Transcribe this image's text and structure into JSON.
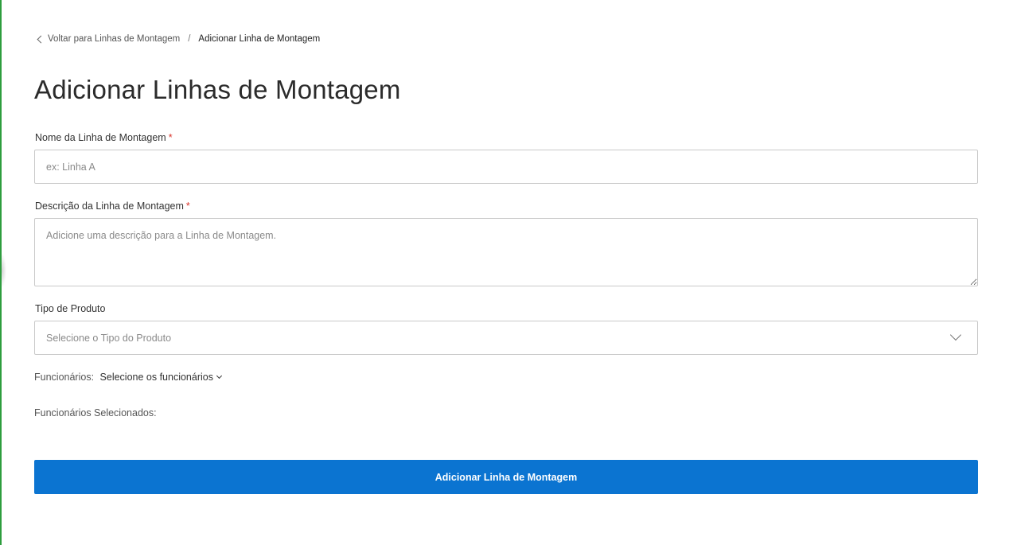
{
  "breadcrumb": {
    "back_label": "Voltar para Linhas de Montagem",
    "separator": "/",
    "current": "Adicionar Linha de Montagem"
  },
  "page": {
    "title": "Adicionar Linhas de Montagem"
  },
  "form": {
    "name": {
      "label": "Nome da Linha de Montagem",
      "required_mark": "*",
      "placeholder": "ex: Linha A",
      "value": ""
    },
    "description": {
      "label": "Descrição da Linha de Montagem",
      "required_mark": "*",
      "placeholder": "Adicione uma descrição para a Linha de Montagem.",
      "value": ""
    },
    "product_type": {
      "label": "Tipo de Produto",
      "placeholder": "Selecione o Tipo do Produto"
    },
    "employees": {
      "label": "Funcionários:",
      "dropdown_label": "Selecione os funcionários",
      "selected_label": "Funcionários Selecionados:"
    },
    "submit_label": "Adicionar Linha de Montagem"
  },
  "colors": {
    "accent": "#0b74d1",
    "required": "#d9342b",
    "left_border": "#2e9d3e"
  }
}
